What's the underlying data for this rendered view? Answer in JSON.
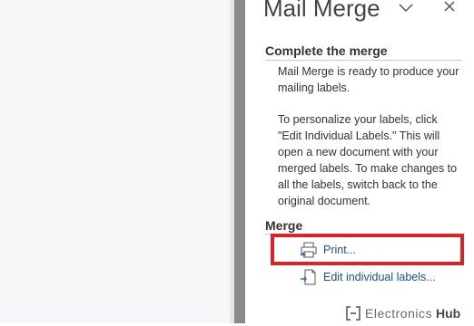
{
  "pane": {
    "title": "Mail Merge",
    "options_icon": "chevron-down-icon",
    "close_icon": "close-icon"
  },
  "complete_section": {
    "heading": "Complete the merge",
    "paragraph1": "Mail Merge is ready to produce your mailing labels.",
    "paragraph2": "To personalize your labels, click \"Edit Individual Labels.\" This will open a new document with your merged labels. To make changes to all the labels, switch back to the original document."
  },
  "merge_section": {
    "heading": "Merge",
    "actions": [
      {
        "label": "Print...",
        "icon": "print-icon"
      },
      {
        "label": "Edit individual labels...",
        "icon": "edit-document-icon"
      }
    ]
  },
  "highlight": {
    "color": "#d8232a"
  },
  "watermark": {
    "text_a": "Electronics",
    "text_b": "Hub"
  }
}
